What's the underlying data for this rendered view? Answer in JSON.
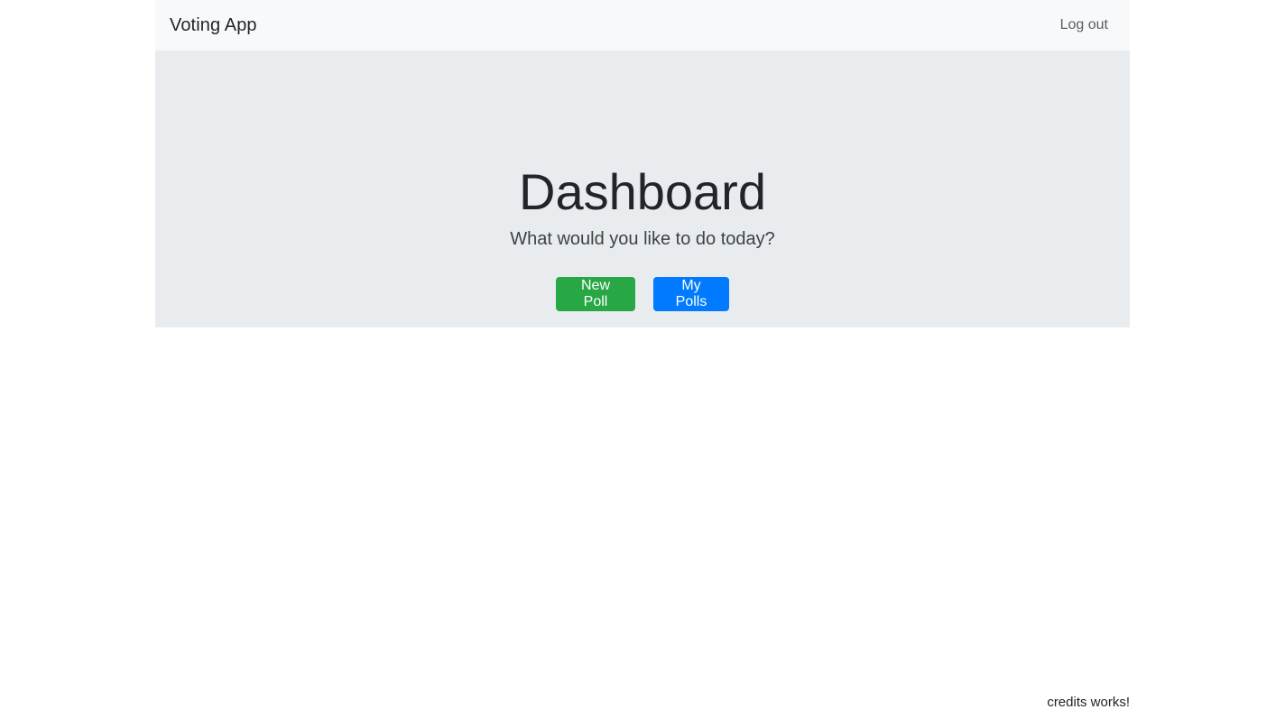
{
  "navbar": {
    "brand": "Voting App",
    "logout_label": "Log out"
  },
  "jumbotron": {
    "title": "Dashboard",
    "lead": "What would you like to do today?",
    "new_poll_label": "New Poll",
    "my_polls_label": "My Polls"
  },
  "footer": {
    "text": "credits works!"
  },
  "colors": {
    "success": "#28a745",
    "primary": "#007bff",
    "navbar_bg": "#f8f9fa",
    "jumbotron_bg": "#e9ecef"
  }
}
